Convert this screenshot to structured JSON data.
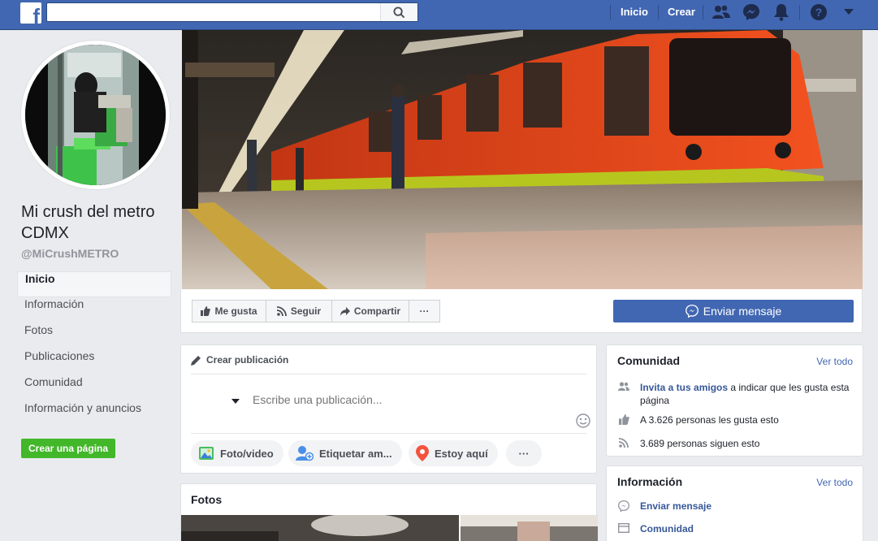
{
  "topbar": {
    "logo": "f",
    "search_placeholder": "",
    "nav_home": "Inicio",
    "nav_create": "Crear"
  },
  "page": {
    "name": "Mi crush del metro CDMX",
    "handle": "@MiCrushMETRO"
  },
  "sidebar": {
    "items": [
      {
        "label": "Inicio",
        "active": true
      },
      {
        "label": "Información"
      },
      {
        "label": "Fotos"
      },
      {
        "label": "Publicaciones"
      },
      {
        "label": "Comunidad"
      },
      {
        "label": "Información y anuncios"
      }
    ],
    "create_page": "Crear una página"
  },
  "actions": {
    "like": "Me gusta",
    "follow": "Seguir",
    "share": "Compartir",
    "more": "···",
    "send_message": "Enviar mensaje"
  },
  "composer": {
    "title": "Crear publicación",
    "placeholder": "Escribe una publicación...",
    "photo_video": "Foto/video",
    "tag_friends": "Etiquetar am...",
    "checkin": "Estoy aquí",
    "more": "···"
  },
  "photos": {
    "title": "Fotos"
  },
  "community": {
    "title": "Comunidad",
    "see_all": "Ver todo",
    "invite_link": "Invita a tus amigos",
    "invite_rest": " a indicar que les gusta esta página",
    "likes": "A 3.626 personas les gusta esto",
    "followers": "3.689 personas siguen esto"
  },
  "information": {
    "title": "Información",
    "see_all": "Ver todo",
    "send_message": "Enviar mensaje",
    "community": "Comunidad"
  },
  "colors": {
    "brand": "#4267b2",
    "create_green": "#42b72a",
    "train_orange": "#f2521f"
  }
}
